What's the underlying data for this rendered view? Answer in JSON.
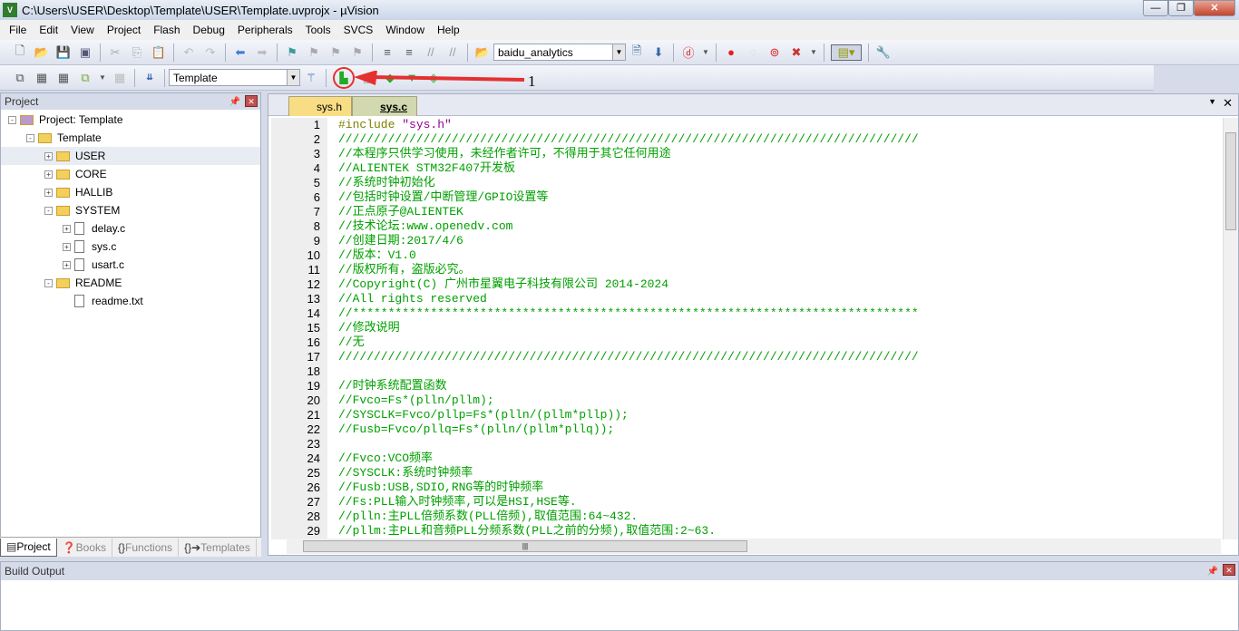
{
  "window": {
    "title": "C:\\Users\\USER\\Desktop\\Template\\USER\\Template.uvprojx - µVision",
    "minimize": "—",
    "maximize": "❐",
    "close": "✕"
  },
  "menu": [
    "File",
    "Edit",
    "View",
    "Project",
    "Flash",
    "Debug",
    "Peripherals",
    "Tools",
    "SVCS",
    "Window",
    "Help"
  ],
  "toolbar1": {
    "find_combo": "baidu_analytics"
  },
  "toolbar2": {
    "target_combo": "Template",
    "annotation_label": "1",
    "highlight_color": "#e53030"
  },
  "project_panel": {
    "title": "Project",
    "tree": [
      {
        "label": "Project: Template",
        "level": 0,
        "type": "project",
        "exp": "-"
      },
      {
        "label": "Template",
        "level": 1,
        "type": "folder",
        "exp": "-"
      },
      {
        "label": "USER",
        "level": 2,
        "type": "folder",
        "exp": "+"
      },
      {
        "label": "CORE",
        "level": 2,
        "type": "folder",
        "exp": "+"
      },
      {
        "label": "HALLIB",
        "level": 2,
        "type": "folder",
        "exp": "+"
      },
      {
        "label": "SYSTEM",
        "level": 2,
        "type": "folder",
        "exp": "-"
      },
      {
        "label": "delay.c",
        "level": 3,
        "type": "file",
        "exp": "+"
      },
      {
        "label": "sys.c",
        "level": 3,
        "type": "file",
        "exp": "+"
      },
      {
        "label": "usart.c",
        "level": 3,
        "type": "file",
        "exp": "+"
      },
      {
        "label": "README",
        "level": 2,
        "type": "folder",
        "exp": "-"
      },
      {
        "label": "readme.txt",
        "level": 3,
        "type": "file",
        "exp": ""
      }
    ],
    "tabs": [
      "Project",
      "Books",
      "Functions",
      "Templates"
    ]
  },
  "editor": {
    "tabs": [
      {
        "label": "sys.h",
        "active": false
      },
      {
        "label": "sys.c",
        "active": true
      }
    ],
    "lines": [
      "#include \"sys.h\"",
      "//////////////////////////////////////////////////////////////////////////////////",
      "//本程序只供学习使用，未经作者许可，不得用于其它任何用途",
      "//ALIENTEK STM32F407开发板",
      "//系统时钟初始化",
      "//包括时钟设置/中断管理/GPIO设置等",
      "//正点原子@ALIENTEK",
      "//技术论坛:www.openedv.com",
      "//创建日期:2017/4/6",
      "//版本：V1.0",
      "//版权所有，盗版必究。",
      "//Copyright(C) 广州市星翼电子科技有限公司 2014-2024",
      "//All rights reserved",
      "//********************************************************************************",
      "//修改说明",
      "//无",
      "//////////////////////////////////////////////////////////////////////////////////",
      "",
      "//时钟系统配置函数",
      "//Fvco=Fs*(plln/pllm);",
      "//SYSCLK=Fvco/pllp=Fs*(plln/(pllm*pllp));",
      "//Fusb=Fvco/pllq=Fs*(plln/(pllm*pllq));",
      "",
      "//Fvco:VCO频率",
      "//SYSCLK:系统时钟频率",
      "//Fusb:USB,SDIO,RNG等的时钟频率",
      "//Fs:PLL输入时钟频率,可以是HSI,HSE等.",
      "//plln:主PLL倍频系数(PLL倍频),取值范围:64~432.",
      "//pllm:主PLL和音频PLL分频系数(PLL之前的分频),取值范围:2~63."
    ]
  },
  "build_output": {
    "title": "Build Output"
  }
}
